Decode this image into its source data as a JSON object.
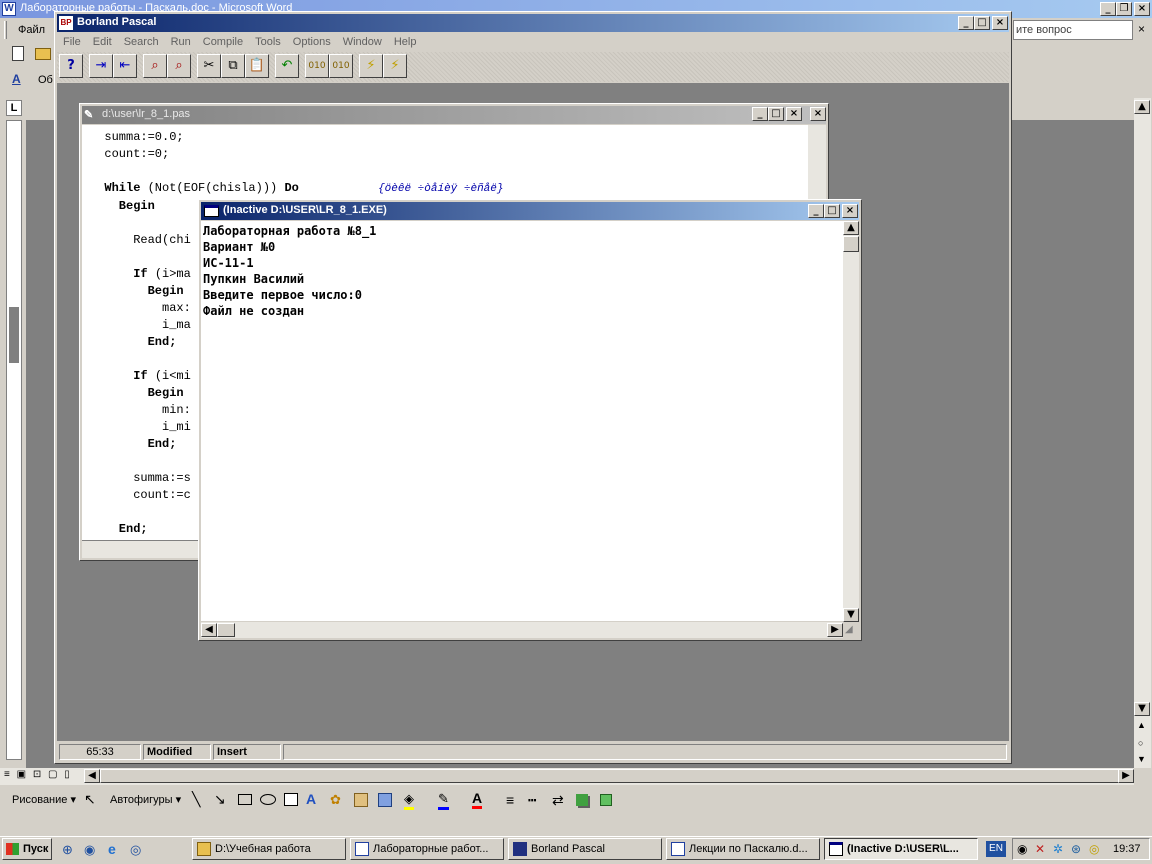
{
  "word": {
    "title": "Лабораторные работы - Паскаль.doc - Microsoft Word",
    "menu_file": "Файл",
    "help_placeholder": "ите вопрос",
    "style_label": "Об",
    "ruler_marker": "L",
    "draw_toolbar": {
      "draw_label": "Рисование ▾",
      "autoshapes_label": "Автофигуры ▾"
    }
  },
  "bp": {
    "title": "Borland Pascal",
    "menu": [
      "File",
      "Edit",
      "Search",
      "Run",
      "Compile",
      "Tools",
      "Options",
      "Window",
      "Help"
    ],
    "editor": {
      "title": "d:\\user\\lr_8_1.pas",
      "lines": {
        "l1": "  summa:=0.0;",
        "l2": "  count:=0;",
        "l3_kw": "  While ",
        "l3_rest": "(Not(EOF(chisla))) ",
        "l3_do": "Do",
        "l3_comment": "{öèêë ÷òåíèÿ ÷èñåë}",
        "l4": "    Begin",
        "l5": "      Read(chi",
        "l6_kw": "      If ",
        "l6_rest": "(i>ma",
        "l7": "        Begin",
        "l8": "          max:",
        "l9": "          i_ma",
        "l10": "        End;",
        "l11_kw": "      If ",
        "l11_rest": "(i<mi",
        "l12": "        Begin",
        "l13": "          min:",
        "l14": "          i_mi",
        "l15": "        End;",
        "l16": "      summa:=s",
        "l17": "      count:=c",
        "l18": "    End;"
      }
    },
    "status": {
      "position": "65:33",
      "modified": "Modified",
      "insert": "Insert"
    }
  },
  "console": {
    "title": "(Inactive D:\\USER\\LR_8_1.EXE)",
    "lines": [
      "Лабораторная работа №8_1",
      "Вариант №0",
      "ИС-11-1",
      "Пупкин Василий",
      "",
      "Введите первое число:0",
      "Файл не создан"
    ]
  },
  "taskbar": {
    "start_label": "Пуск",
    "tasks": [
      {
        "label": "D:\\Учебная работа",
        "active": false
      },
      {
        "label": "Лабораторные работ...",
        "active": false
      },
      {
        "label": "Borland Pascal",
        "active": false
      },
      {
        "label": "Лекции по Паскалю.d...",
        "active": false
      },
      {
        "label": "(Inactive D:\\USER\\L...",
        "active": true
      }
    ],
    "language": "EN",
    "clock": "19:37"
  },
  "colors": {
    "active_title_start": "#0a246a",
    "active_title_end": "#a6caf0",
    "workspace_gray": "#808080",
    "code_default": "#000000",
    "code_number": "#0000aa"
  }
}
